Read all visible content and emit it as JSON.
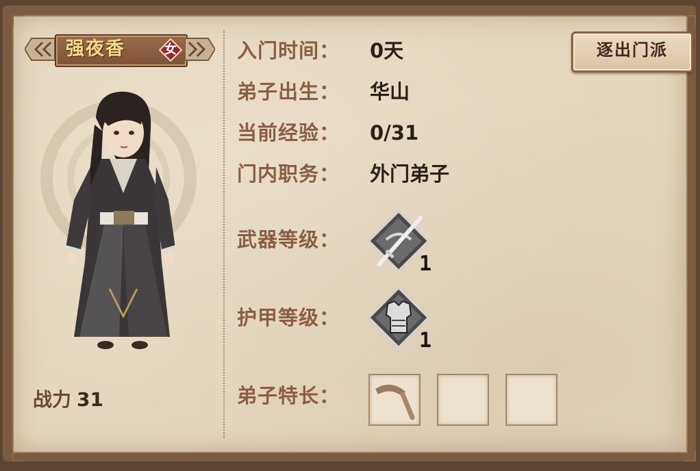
{
  "character": {
    "name": "强夜香",
    "gender": "女",
    "power_label": "战力",
    "power_value": "31"
  },
  "info": {
    "join_time_label": "入门时间：",
    "join_time_value": "0天",
    "origin_label": "弟子出生：",
    "origin_value": "华山",
    "exp_label": "当前经验：",
    "exp_value": "0/31",
    "position_label": "门内职务：",
    "position_value": "外门弟子",
    "weapon_label": "武器等级：",
    "weapon_level": "1",
    "armor_label": "护甲等级：",
    "armor_level": "1",
    "specialty_label": "弟子特长："
  },
  "specialty_slots": [
    "sickle-icon",
    "empty",
    "empty"
  ],
  "actions": {
    "expel_label": "逐出门派"
  },
  "colors": {
    "paper": "#e5d7bf",
    "label": "#8a5e44",
    "plate": "#8a5c3c",
    "gender_badge": "#8e2a36"
  }
}
